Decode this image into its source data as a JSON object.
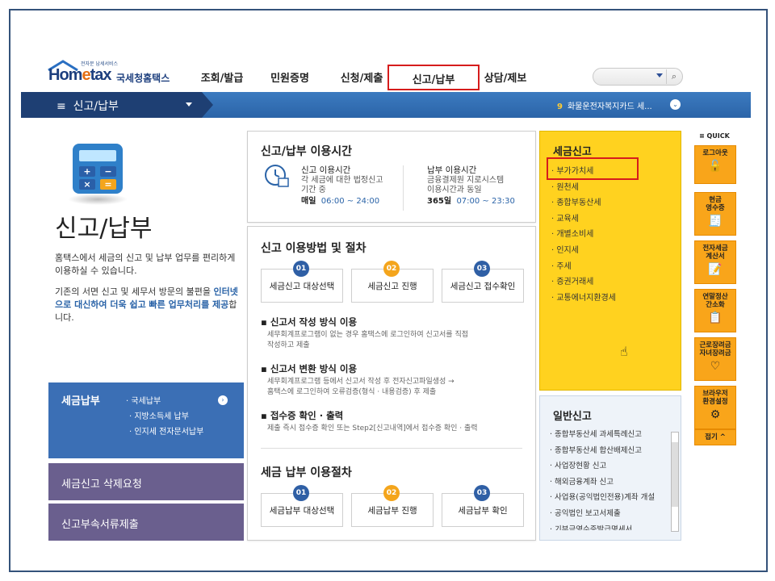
{
  "header": {
    "logo_small": "전자문 납세서비스",
    "logo_main_a": "Hom",
    "logo_main_e": "e",
    "logo_main_b": "tax",
    "logo_kr": "국세청홈택스",
    "nav": [
      "조회/발급",
      "민원증명",
      "신청/제출",
      "신고/납부",
      "상담/제보"
    ],
    "search_icon": "magnifier-icon"
  },
  "bluebar": {
    "menu_icon": "≡",
    "menu_label": "신고/납부",
    "notice_num": "9",
    "notice_text": "화물운전자복지카드 세...",
    "notice_btn": "⌄"
  },
  "left": {
    "title": "신고/납부",
    "desc1": "홈택스에서 세금의 신고 및 납부 업무를 편리하게 이용하실 수 있습니다.",
    "desc2a": "기존의 서면 신고 및 세무서 방문의 불편을 ",
    "desc2b": "인터넷으로 대신하여 더욱 쉽고 빠른 업무처리를 제공",
    "desc2c": "합니다.",
    "menu_blue_title": "세금납부",
    "menu_blue_items": [
      "· 국세납부",
      "· 지방소득세 납부",
      "· 인지세 전자문서납부"
    ],
    "menu_purple": [
      "세금신고 삭제요청",
      "신고부속서류제출"
    ]
  },
  "center": {
    "time_title": "신고/납부 이용시간",
    "report_time_head": "신고 이용시간",
    "report_time_desc": [
      "각 세금에 대한 법정신고",
      "기간 중"
    ],
    "report_time_day": "매일",
    "report_time_hours": "06:00 ~ 24:00",
    "pay_time_head": "납부 이용시간",
    "pay_time_desc": [
      "금융결제원 지로시스템",
      "이용시간과 동일"
    ],
    "pay_time_day": "365일",
    "pay_time_hours": "07:00 ~ 23:30",
    "method_title": "신고 이용방법 및 절차",
    "steps1": [
      {
        "num": "01",
        "label": "세금신고 대상선택"
      },
      {
        "num": "02",
        "label": "세금신고 진행"
      },
      {
        "num": "03",
        "label": "세금신고 접수확인"
      }
    ],
    "bullets": [
      {
        "head": "신고서 작성 방식 이용",
        "desc": [
          "세무회계프로그램이 없는 경우 홈택스에 로그인하여 신고서를 직접",
          "작성하고 제출"
        ]
      },
      {
        "head": "신고서 변환 방식 이용",
        "desc": [
          "세무회계프로그램 등에서 신고서 작성 후 전자신고파일생성 →",
          "홈택스에 로그인하여 오류검증(형식 · 내용검증) 후 제출"
        ]
      },
      {
        "head": "접수증 확인 · 출력",
        "desc": [
          "제출 즉시 접수증 확인 또는 Step2[신고내역]에서 접수증 확인 · 출력"
        ]
      }
    ],
    "pay_title": "세금 납부 이용절차",
    "steps2": [
      {
        "num": "01",
        "label": "세금납부 대상선택"
      },
      {
        "num": "02",
        "label": "세금납부 진행"
      },
      {
        "num": "03",
        "label": "세금납부 확인"
      }
    ]
  },
  "tax_report": {
    "title": "세금신고",
    "items": [
      "· 부가가치세",
      "· 원천세",
      "· 종합부동산세",
      "· 교육세",
      "· 개별소비세",
      "· 인지세",
      "· 주세",
      "· 증권거래세",
      "· 교통에너지환경세"
    ]
  },
  "general_report": {
    "title": "일반신고",
    "items": [
      "· 종합부동산세 과세특례신고",
      "· 종합부동산세 합산배제신고",
      "· 사업장현황 신고",
      "· 해외금융계좌 신고",
      "· 사업용(공익법인전용)계좌 개설",
      "· 공익법인 보고서제출",
      "· 기부금영수증발급명세서"
    ]
  },
  "quick": {
    "title": "≡ QUICK",
    "items": [
      {
        "label": "로그아웃",
        "icon": "🔓"
      },
      {
        "label": "현금\n영수증",
        "icon": "🧾"
      },
      {
        "label": "전자세금\n계산서",
        "icon": "📝"
      },
      {
        "label": "연말정산\n간소화",
        "icon": "📋"
      },
      {
        "label": "근로장려금\n자녀장려금",
        "icon": "♡"
      },
      {
        "label": "브라우저\n환경설정",
        "icon": "⚙"
      }
    ],
    "close": "접기 ^"
  },
  "colors": {
    "accent_blue": "#2b64a8",
    "highlight_red": "#d61c1c",
    "yellow": "#ffd21f",
    "orange": "#f9a51a"
  }
}
